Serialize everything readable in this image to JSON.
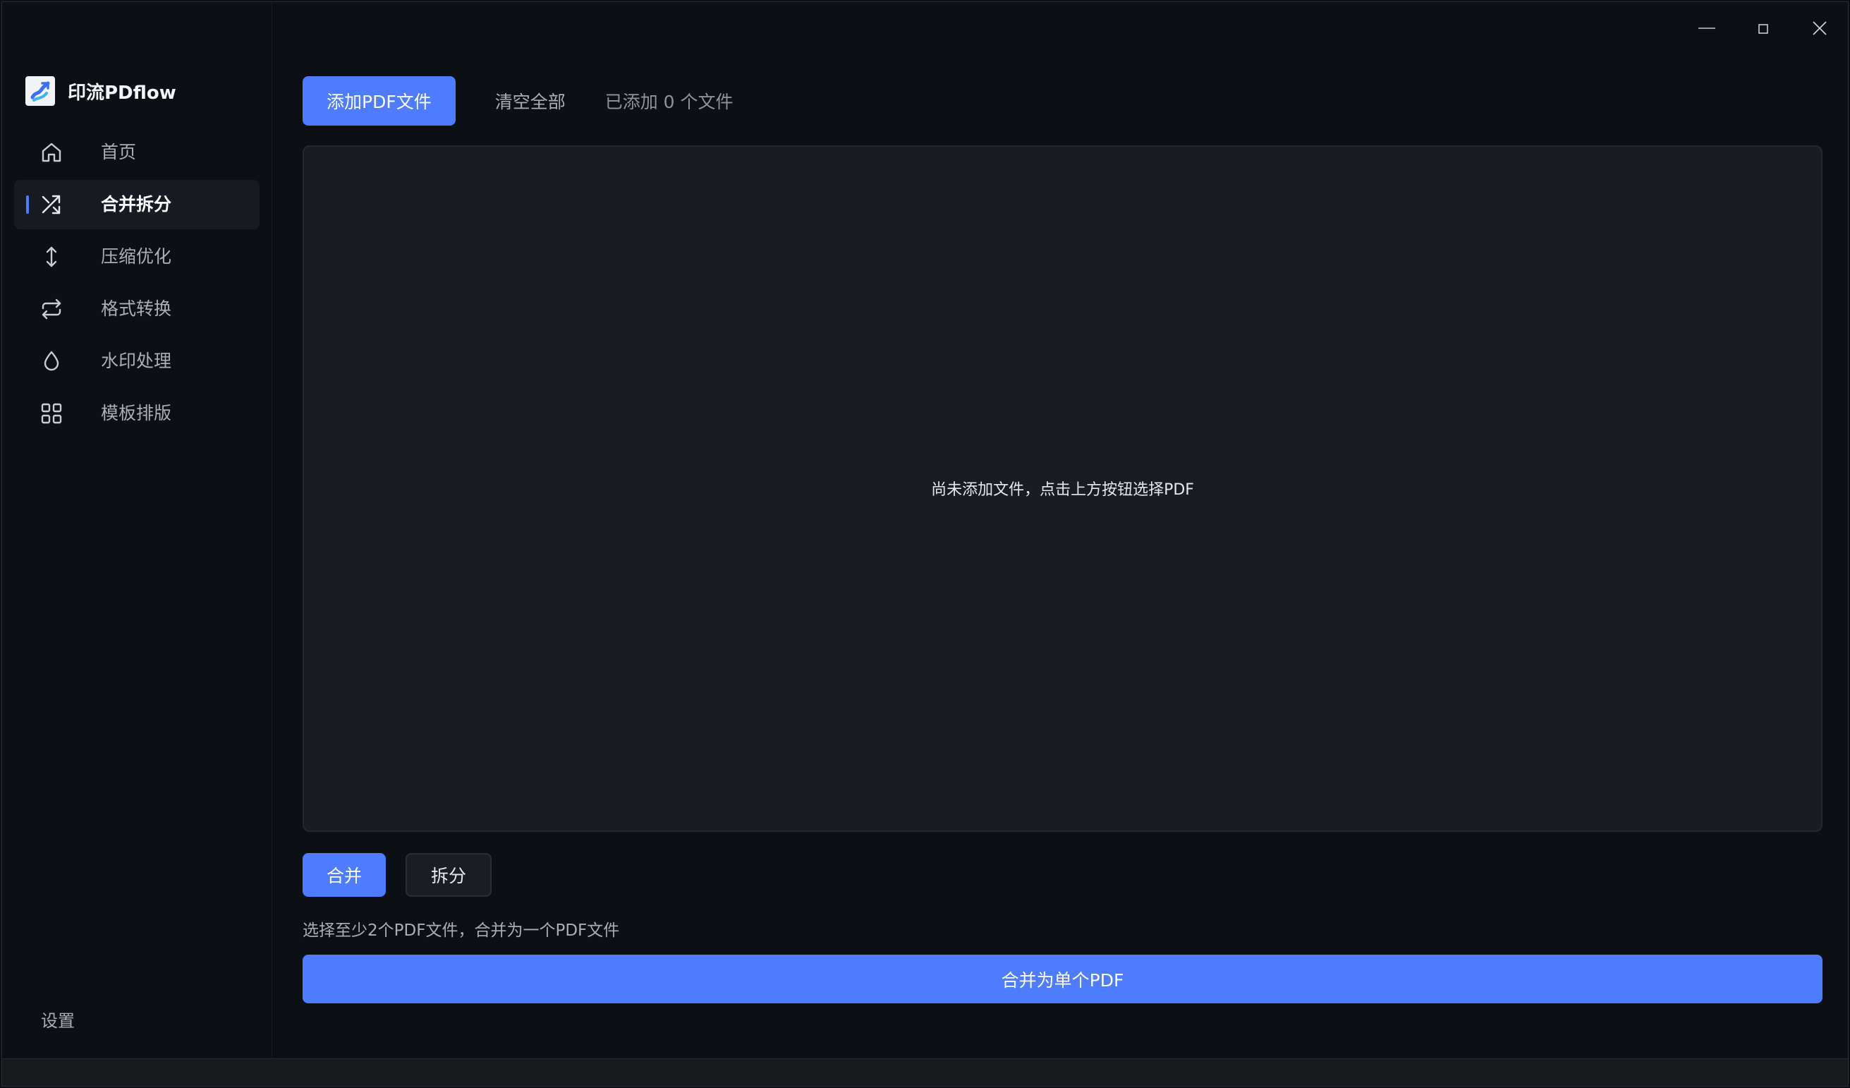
{
  "app": {
    "name": "印流PDflow"
  },
  "window_controls": {
    "minimize_icon": "minimize-icon",
    "maximize_icon": "maximize-icon",
    "close_icon": "close-icon"
  },
  "sidebar": {
    "items": [
      {
        "label": "首页",
        "icon": "home-icon",
        "active": false
      },
      {
        "label": "合并拆分",
        "icon": "shuffle-icon",
        "active": true
      },
      {
        "label": "压缩优化",
        "icon": "vertical-arrows-icon",
        "active": false
      },
      {
        "label": "格式转换",
        "icon": "repeat-icon",
        "active": false
      },
      {
        "label": "水印处理",
        "icon": "droplet-icon",
        "active": false
      },
      {
        "label": "模板排版",
        "icon": "grid-icon",
        "active": false
      }
    ],
    "settings_label": "设置"
  },
  "toolbar": {
    "add_label": "添加PDF文件",
    "clear_label": "清空全部",
    "count_text": "已添加 0 个文件"
  },
  "dropzone": {
    "empty_text": "尚未添加文件，点击上方按钮选择PDF"
  },
  "mode": {
    "merge_label": "合并",
    "split_label": "拆分",
    "selected": "合并"
  },
  "hint": "选择至少2个PDF文件，合并为一个PDF文件",
  "submit_label": "合并为单个PDF",
  "colors": {
    "accent": "#4d7cfe",
    "background": "#0c0f13",
    "panel": "#1b1c23",
    "text_primary": "#ffffff",
    "text_secondary": "#a9aeb7"
  }
}
